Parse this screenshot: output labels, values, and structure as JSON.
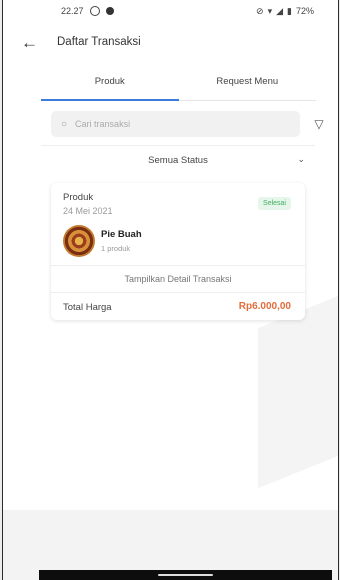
{
  "statusbar": {
    "time": "22.27",
    "battery": "72%"
  },
  "appbar": {
    "title": "Daftar Transaksi"
  },
  "tabs": [
    {
      "label": "Produk",
      "active": true
    },
    {
      "label": "Request Menu",
      "active": false
    }
  ],
  "search": {
    "placeholder": "Cari transaksi"
  },
  "status_filter": {
    "label": "Semua Status"
  },
  "transaction": {
    "category": "Produk",
    "date": "24 Mei 2021",
    "status": "Selesai",
    "product_name": "Pie Buah",
    "product_qty": "1 produk",
    "detail_button": "Tampilkan Detail Transaksi",
    "total_label": "Total Harga",
    "total_value": "Rp6.000,00"
  },
  "colors": {
    "accent": "#3b7bd9",
    "price": "#e06d3c",
    "success": "#3fae62"
  }
}
